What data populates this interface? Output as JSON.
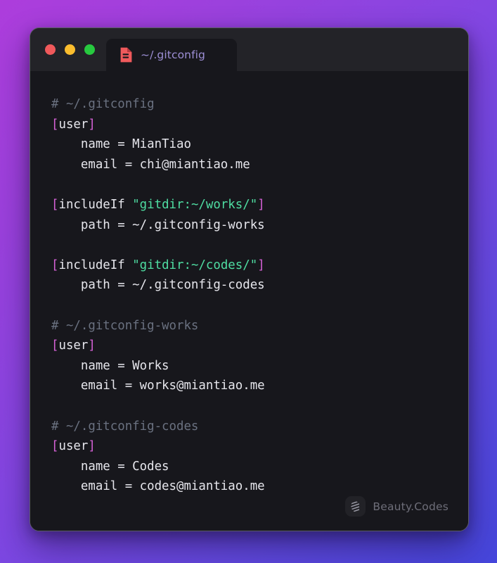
{
  "window": {
    "traffic_lights": [
      {
        "name": "close",
        "color": "#f0595b"
      },
      {
        "name": "minimize",
        "color": "#fbbd2e"
      },
      {
        "name": "maximize",
        "color": "#27c93f"
      }
    ],
    "tab": {
      "icon": "file-icon",
      "icon_color": "#f05a5c",
      "label": "~/.gitconfig"
    }
  },
  "theme": {
    "background_gradient_from": "#ad3ddc",
    "background_gradient_to": "#4546dc",
    "window_background": "#17171c",
    "titlebar_background": "#232328",
    "comment": "#6a7180",
    "bracket": "#d661d6",
    "string": "#4fdda2",
    "text": "#e6e6ec"
  },
  "code": {
    "language": "gitconfig",
    "lines": [
      {
        "tokens": [
          {
            "t": "comment",
            "v": "# ~/.gitconfig"
          }
        ]
      },
      {
        "tokens": [
          {
            "t": "bracket",
            "v": "["
          },
          {
            "t": "section",
            "v": "user"
          },
          {
            "t": "bracket",
            "v": "]"
          }
        ]
      },
      {
        "tokens": [
          {
            "t": "key",
            "v": "    name = MianTiao"
          }
        ]
      },
      {
        "tokens": [
          {
            "t": "key",
            "v": "    email = chi@miantiao.me"
          }
        ]
      },
      {
        "tokens": []
      },
      {
        "tokens": [
          {
            "t": "bracket",
            "v": "["
          },
          {
            "t": "section",
            "v": "includeIf "
          },
          {
            "t": "string",
            "v": "\"gitdir:~/works/\""
          },
          {
            "t": "bracket",
            "v": "]"
          }
        ]
      },
      {
        "tokens": [
          {
            "t": "key",
            "v": "    path = ~/.gitconfig-works"
          }
        ]
      },
      {
        "tokens": []
      },
      {
        "tokens": [
          {
            "t": "bracket",
            "v": "["
          },
          {
            "t": "section",
            "v": "includeIf "
          },
          {
            "t": "string",
            "v": "\"gitdir:~/codes/\""
          },
          {
            "t": "bracket",
            "v": "]"
          }
        ]
      },
      {
        "tokens": [
          {
            "t": "key",
            "v": "    path = ~/.gitconfig-codes"
          }
        ]
      },
      {
        "tokens": []
      },
      {
        "tokens": [
          {
            "t": "comment",
            "v": "# ~/.gitconfig-works"
          }
        ]
      },
      {
        "tokens": [
          {
            "t": "bracket",
            "v": "["
          },
          {
            "t": "section",
            "v": "user"
          },
          {
            "t": "bracket",
            "v": "]"
          }
        ]
      },
      {
        "tokens": [
          {
            "t": "key",
            "v": "    name = Works"
          }
        ]
      },
      {
        "tokens": [
          {
            "t": "key",
            "v": "    email = works@miantiao.me"
          }
        ]
      },
      {
        "tokens": []
      },
      {
        "tokens": [
          {
            "t": "comment",
            "v": "# ~/.gitconfig-codes"
          }
        ]
      },
      {
        "tokens": [
          {
            "t": "bracket",
            "v": "["
          },
          {
            "t": "section",
            "v": "user"
          },
          {
            "t": "bracket",
            "v": "]"
          }
        ]
      },
      {
        "tokens": [
          {
            "t": "key",
            "v": "    name = Codes"
          }
        ]
      },
      {
        "tokens": [
          {
            "t": "key",
            "v": "    email = codes@miantiao.me"
          }
        ]
      }
    ]
  },
  "watermark": {
    "icon": "beauty-codes-logo-icon",
    "label": "Beauty.Codes"
  }
}
